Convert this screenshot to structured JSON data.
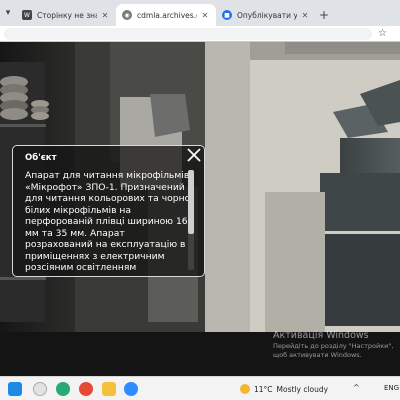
{
  "browser": {
    "tabs": [
      {
        "title": "Сторінку не знайдено | Центр",
        "favicon": "wiki-icon",
        "active": false
      },
      {
        "title": "cdmla.archives.gov.ua/floor3/",
        "favicon": "globe-icon",
        "active": true
      },
      {
        "title": "Опублікувати учасника • Zoom",
        "favicon": "zoom-icon",
        "active": false
      }
    ],
    "new_tab_label": "+"
  },
  "popup": {
    "title": "Об'єкт",
    "text": "Апарат для читання мікрофільмів «Мікрофот» ЗПО-1. Призначений для читання кольорових та чорно-білих мікрофільмів на перфорованій плівці шириною 16 мм та 35 мм. Апарат розрахований на експлуатацію в приміщеннях з електричним розсіяним освітленням",
    "scroll_fraction": 0.64
  },
  "watermark": {
    "title": "Активація Windows",
    "subtitle": "Перейдіть до розділу \"Настройки\", щоб активувати Windows."
  },
  "taskbar": {
    "icons": [
      "start-icon",
      "search-icon",
      "task-view-icon",
      "widgets-icon",
      "edge-icon",
      "chrome-icon",
      "explorer-icon",
      "store-icon",
      "zoom-icon"
    ],
    "weather_temp": "11°C",
    "weather_desc": "Mostly cloudy",
    "language": "ENG"
  },
  "colors": {
    "tab_strip": "#dfe3e8",
    "active_tab": "#ffffff",
    "popup_bg": "#141414",
    "taskbar": "#f3f3f3",
    "accent_blue": "#1a73e8"
  }
}
